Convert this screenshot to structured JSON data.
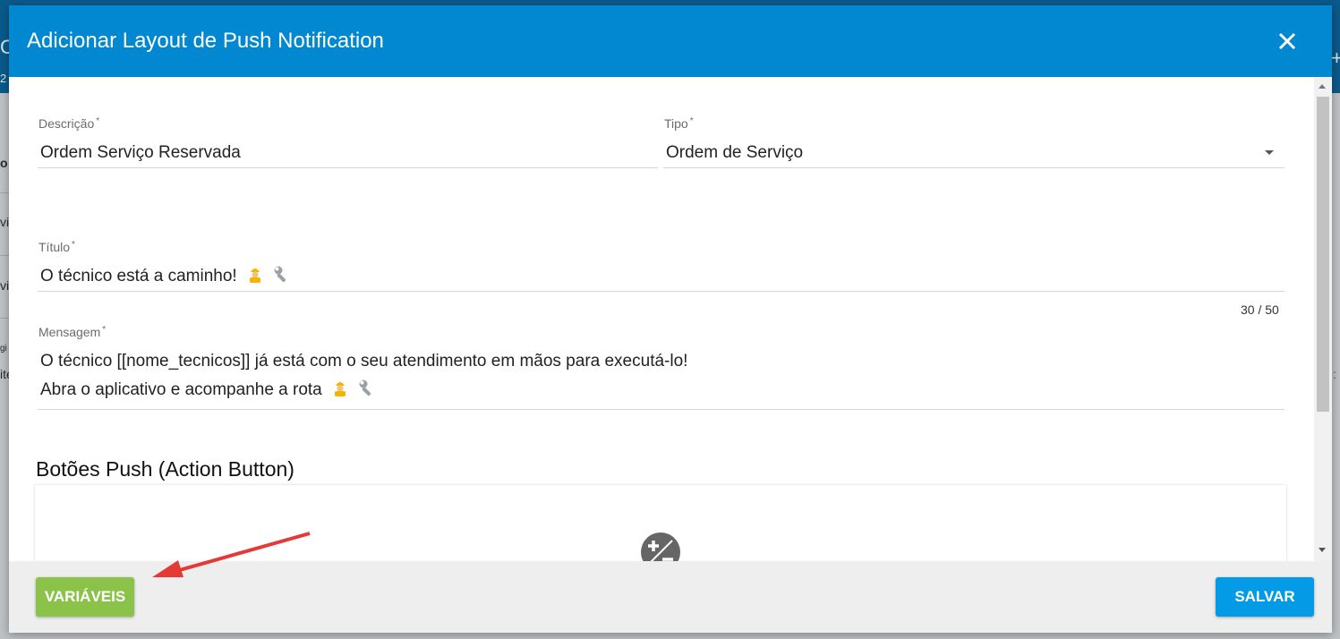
{
  "background": {
    "fragments": [
      "C",
      "2",
      "o",
      "vi",
      "vi",
      "gi",
      "ite",
      ":"
    ]
  },
  "modal": {
    "title": "Adicionar Layout de Push Notification",
    "close_icon": "close-icon"
  },
  "form": {
    "descricao": {
      "label": "Descrição",
      "required": "*",
      "value": "Ordem Serviço Reservada"
    },
    "tipo": {
      "label": "Tipo",
      "required": "*",
      "value": "Ordem de Serviço"
    },
    "titulo": {
      "label": "Título",
      "required": "*",
      "value": "O técnico está a caminho!",
      "counter": "30 / 50"
    },
    "mensagem": {
      "label": "Mensagem",
      "required": "*",
      "line1": "O técnico [[nome_tecnicos]] já está com o seu atendimento em mãos para executá-lo!",
      "line2": "Abra o aplicativo e acompanhe a rota"
    }
  },
  "action_buttons": {
    "title": "Botões Push (Action Button)",
    "icon": "add-remove-icon"
  },
  "footer": {
    "variables_label": "VARIÁVEIS",
    "save_label": "SALVAR"
  },
  "colors": {
    "header": "#0288d1",
    "variables_button": "#8bc34a",
    "save_button": "#039be5",
    "annotation_arrow": "#e53935"
  }
}
